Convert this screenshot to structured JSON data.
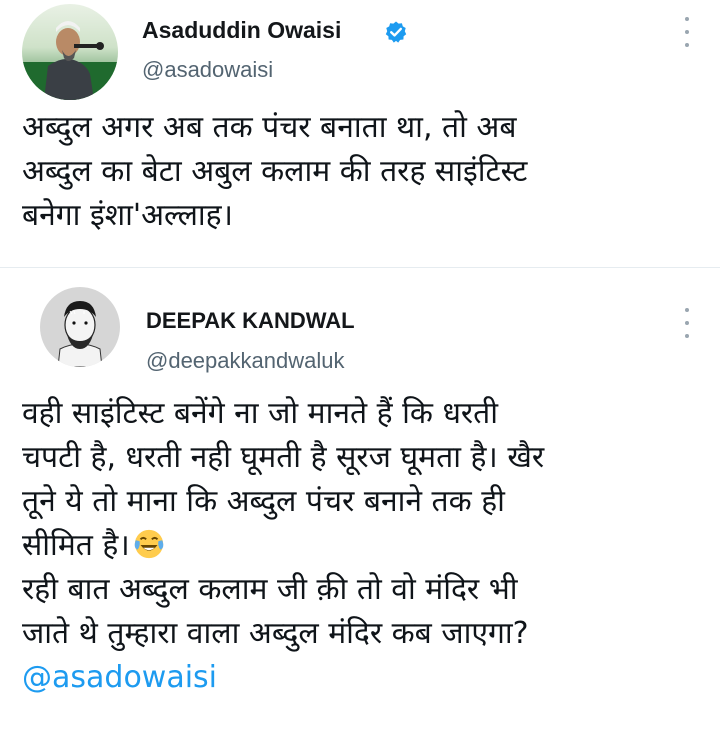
{
  "tweets": [
    {
      "author": {
        "name": "Asaduddin Owaisi",
        "handle": "@asadowaisi",
        "verified": true,
        "avatar_icon": "avatar-photo-man-at-microphone"
      },
      "more_icon": "more-vertical-icon",
      "lines": [
        "अब्दुल अगर अब तक पंचर बनाता था, तो अब",
        "अब्दुल का बेटा अबुल कलाम की तरह साइंटिस्ट",
        "बनेगा इंशा'अल्लाह।"
      ]
    },
    {
      "author": {
        "name": "DEEPAK KANDWAL",
        "handle": "@deepakkandwaluk",
        "verified": false,
        "avatar_icon": "avatar-sketch-man-with-beard"
      },
      "more_icon": "more-vertical-icon",
      "lines": [
        "वही साइंटिस्ट बनेंगे ना जो मानते हैं कि धरती",
        "चपटी है, धरती नही घूमती है सूरज घूमता है। खैर",
        "तूने ये तो माना कि अब्दुल पंचर बनाने तक ही",
        "सीमित है।",
        "रही बात अब्दुल कलाम जी क़ी तो वो मंदिर भी",
        "जाते थे तुम्हारा वाला अब्दुल मंदिर कब जाएगा?"
      ],
      "emoji": "face-with-tears-of-joy-emoji",
      "mention": "@asadowaisi"
    }
  ],
  "colors": {
    "text": "#0f1419",
    "handle": "#536471",
    "link": "#1d9bf0",
    "verified": "#1d9bf0",
    "divider": "#e6ecf0"
  }
}
